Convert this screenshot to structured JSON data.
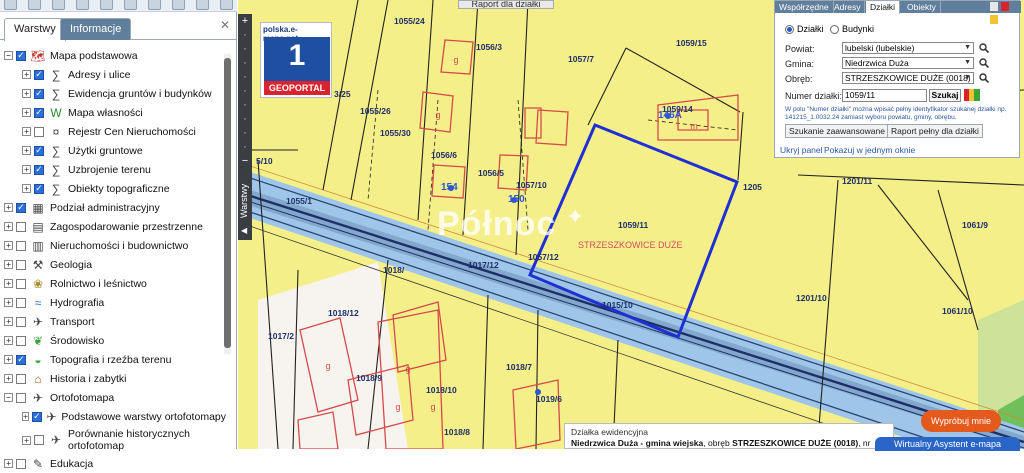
{
  "left_panel": {
    "tabs": [
      {
        "label": "Warstwy",
        "active": true
      },
      {
        "label": "Informacje",
        "active": false
      }
    ],
    "layers": [
      {
        "label": "Mapa podstawowa",
        "expand": "−",
        "checked": true,
        "icon": "map-base-icon",
        "level": 0
      },
      {
        "label": "Adresy i ulice",
        "expand": "+",
        "checked": true,
        "icon": "address-icon",
        "level": 1
      },
      {
        "label": "Ewidencja gruntów i budynków",
        "expand": "+",
        "checked": true,
        "icon": "cadastre-icon",
        "level": 1
      },
      {
        "label": "Mapa własności",
        "expand": "+",
        "checked": true,
        "icon": "ownership-icon",
        "level": 1
      },
      {
        "label": "Rejestr Cen Nieruchomości",
        "expand": "+",
        "checked": false,
        "icon": "price-register-icon",
        "level": 1
      },
      {
        "label": "Użytki gruntowe",
        "expand": "+",
        "checked": true,
        "icon": "land-use-icon",
        "level": 1
      },
      {
        "label": "Uzbrojenie terenu",
        "expand": "+",
        "checked": true,
        "icon": "utilities-icon",
        "level": 1
      },
      {
        "label": "Obiekty topograficzne",
        "expand": "+",
        "checked": true,
        "icon": "topo-objects-icon",
        "level": 1
      },
      {
        "label": "Podział administracyjny",
        "expand": "+",
        "checked": true,
        "icon": "admin-division-icon",
        "level": 0
      },
      {
        "label": "Zagospodarowanie przestrzenne",
        "expand": "+",
        "checked": false,
        "icon": "spatial-planning-icon",
        "level": 0
      },
      {
        "label": "Nieruchomości i budownictwo",
        "expand": "+",
        "checked": false,
        "icon": "real-estate-icon",
        "level": 0
      },
      {
        "label": "Geologia",
        "expand": "+",
        "checked": false,
        "icon": "geology-icon",
        "level": 0
      },
      {
        "label": "Rolnictwo i leśnictwo",
        "expand": "+",
        "checked": false,
        "icon": "agriculture-icon",
        "level": 0
      },
      {
        "label": "Hydrografia",
        "expand": "+",
        "checked": false,
        "icon": "hydrography-icon",
        "level": 0
      },
      {
        "label": "Transport",
        "expand": "+",
        "checked": false,
        "icon": "transport-icon",
        "level": 0
      },
      {
        "label": "Środowisko",
        "expand": "+",
        "checked": false,
        "icon": "environment-icon",
        "level": 0
      },
      {
        "label": "Topografia i rzeźba terenu",
        "expand": "+",
        "checked": true,
        "icon": "topography-icon",
        "level": 0
      },
      {
        "label": "Historia i zabytki",
        "expand": "+",
        "checked": false,
        "icon": "history-icon",
        "level": 0
      },
      {
        "label": "Ortofotomapa",
        "expand": "−",
        "checked": false,
        "icon": "orthophoto-icon",
        "level": 0
      },
      {
        "label": "Podstawowe warstwy ortofotomapy",
        "expand": "+",
        "checked": true,
        "icon": "orthophoto-layers-icon",
        "level": 1
      },
      {
        "label": "Porównanie historycznych ortofotomap",
        "expand": "+",
        "checked": false,
        "icon": "orthophoto-compare-icon",
        "level": 1,
        "two_line": true
      },
      {
        "label": "Edukacja",
        "expand": "+",
        "checked": false,
        "icon": "education-icon",
        "level": 0
      }
    ]
  },
  "map": {
    "report_button": "Raport dla działki",
    "side_handle": "Warstwy",
    "zoom_plus": "+",
    "zoom_minus": "−",
    "geoportal": {
      "url": "polska.e-mapa.net",
      "number": "1",
      "label": "GEOPORTAL"
    },
    "watermark": "Północ",
    "region_label": "STRZESZKOWICE DUŻE",
    "parcel_labels": [
      "1055/24",
      "1056/3",
      "1057/7",
      "1059/15",
      "3/25",
      "1055/26",
      "1055/30",
      "1056/6",
      "1056/5",
      "1057/10",
      "1059/14",
      "1059/11",
      "1201/11",
      "1061/9",
      "1055/1",
      "1018/",
      "1018/10",
      "1018/9",
      "1017/2",
      "1201/10",
      "1061/10",
      "1018/8",
      "1017/12",
      "1205",
      "1015/10",
      "1018/7",
      "1018/12",
      "1019/6",
      "1057/12",
      "5/10"
    ],
    "building_marks": [
      "g",
      "g",
      "g",
      "g",
      "g",
      "g",
      "m"
    ],
    "address_numbers": [
      "154",
      "150",
      "146A"
    ]
  },
  "search_panel": {
    "tabs": [
      "Współrzędne",
      "Adresy",
      "Działki",
      "Obiekty"
    ],
    "active_tab": "Działki",
    "radio": {
      "option1": "Działki",
      "option2": "Budynki",
      "selected": "Działki"
    },
    "fields": [
      {
        "label": "Powiat:",
        "value": "lubelski (lubelskie)"
      },
      {
        "label": "Gmina:",
        "value": "Niedrzwica Duża"
      },
      {
        "label": "Obręb:",
        "value": "STRZESZKOWICE DUŻE (0018)"
      }
    ],
    "number_label": "Numer działki:",
    "number_value": "1059/11",
    "search_button": "Szukaj",
    "hint": "W polu \"Numer działki\" można wpisać pełny identyfikator szukanej działki np. 141215_1.0032.24 zamiast wyboru powiatu, gminy, obrębu.",
    "advanced_button": "Szukanie zaawansowane",
    "report_button": "Raport pełny dla działki",
    "hide_link": "Ukryj panel",
    "single_window_link": "Pokazuj w jednym oknie"
  },
  "bottom": {
    "info_title": "Działka ewidencyjna",
    "info_prefix": "Niedrzwica Duża - gmina wiejska",
    "info_middle": ", obręb ",
    "info_bold": "STRZESZKOWICE DUŻE (0018)",
    "info_suffix": ", nr",
    "try_button": "Wypróbuj mnie",
    "assistant_button": "Wirtualny Asystent e-mapa"
  },
  "colors": {
    "map_background": "#f5ef8a",
    "road_blue": "#9fc6e8",
    "parcel_highlight": "#1f2fd6",
    "building_red": "#d64a4a",
    "panel_tab_blue": "#5f7f9c",
    "try_orange": "#e45a1c",
    "assistant_blue": "#2a66c8"
  }
}
